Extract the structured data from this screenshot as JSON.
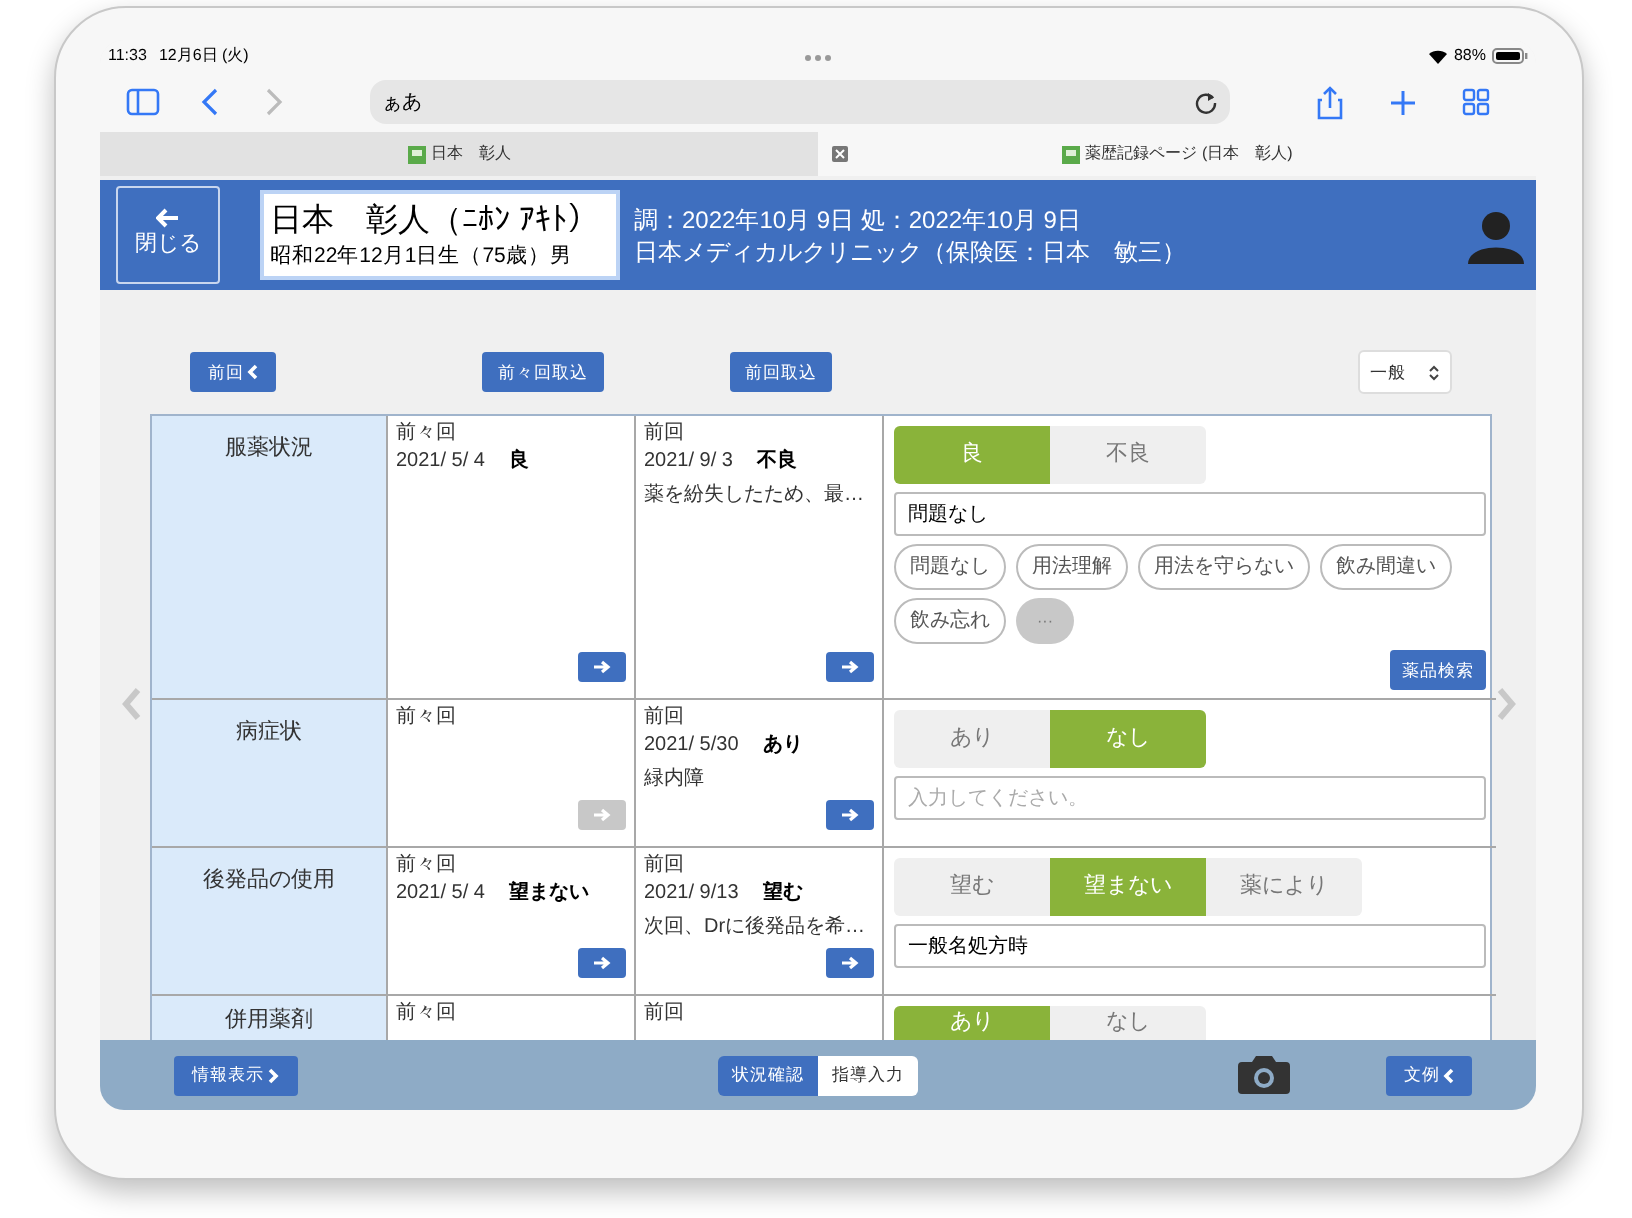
{
  "status_bar": {
    "time": "11:33",
    "date": "12月6日 (火)",
    "battery": "88%"
  },
  "browser": {
    "url": "ぁあ",
    "tabs": [
      {
        "title": "日本　彰人",
        "selected": false
      },
      {
        "title": "薬歴記録ページ (日本　彰人)",
        "selected": true
      }
    ]
  },
  "header": {
    "close_button": "閉じる",
    "patient_name": "日本　彰人（ﾆﾎﾝ ｱｷﾄ）",
    "patient_birth": "昭和22年12月1日生（75歳）男",
    "dates": "調：2022年10月 9日 処：2022年10月 9日",
    "clinic": "日本メディカルクリニック（保険医：日本　敏三）"
  },
  "toolbar": {
    "prev_button": "前回",
    "import_prev_prev": "前々回取込",
    "import_prev": "前回取込",
    "category_select": "一般"
  },
  "rows": [
    {
      "label": "服薬状況",
      "prev_prev": {
        "heading": "前々回",
        "date": "2021/ 5/ 4",
        "value": "良",
        "arrow_disabled": false
      },
      "prev": {
        "heading": "前回",
        "date": "2021/ 9/ 3",
        "value": "不良",
        "note": "薬を紛失したため、最…",
        "arrow_disabled": false
      },
      "options": [
        {
          "label": "良",
          "selected": true
        },
        {
          "label": "不良",
          "selected": false
        }
      ],
      "input": {
        "value": "問題なし"
      },
      "chips": [
        "問題なし",
        "用法理解",
        "用法を守らない",
        "飲み間違い",
        "飲み忘れ"
      ],
      "more_chip": "···",
      "search_button": "薬品検索"
    },
    {
      "label": "病症状",
      "prev_prev": {
        "heading": "前々回",
        "arrow_disabled": true
      },
      "prev": {
        "heading": "前回",
        "date": "2021/ 5/30",
        "value": "あり",
        "note": "緑内障",
        "arrow_disabled": false
      },
      "options": [
        {
          "label": "あり",
          "selected": false
        },
        {
          "label": "なし",
          "selected": true
        }
      ],
      "input": {
        "placeholder": "入力してください。"
      }
    },
    {
      "label": "後発品の使用",
      "prev_prev": {
        "heading": "前々回",
        "date": "2021/ 5/ 4",
        "value": "望まない",
        "arrow_disabled": false
      },
      "prev": {
        "heading": "前回",
        "date": "2021/ 9/13",
        "value": "望む",
        "note": "次回、Drに後発品を希…",
        "arrow_disabled": false
      },
      "options": [
        {
          "label": "望む",
          "selected": false
        },
        {
          "label": "望まない",
          "selected": true
        },
        {
          "label": "薬により",
          "selected": false
        }
      ],
      "input": {
        "value": "一般名処方時"
      }
    },
    {
      "label": "併用薬剤",
      "prev_prev": {
        "heading": "前々回"
      },
      "prev": {
        "heading": "前回"
      },
      "options": [
        {
          "label": "あり",
          "selected": true
        },
        {
          "label": "なし",
          "selected": false
        }
      ]
    }
  ],
  "footer": {
    "info_button": "情報表示",
    "segments": [
      {
        "label": "状況確認",
        "selected": true
      },
      {
        "label": "指導入力",
        "selected": false
      }
    ],
    "examples_button": "文例"
  }
}
